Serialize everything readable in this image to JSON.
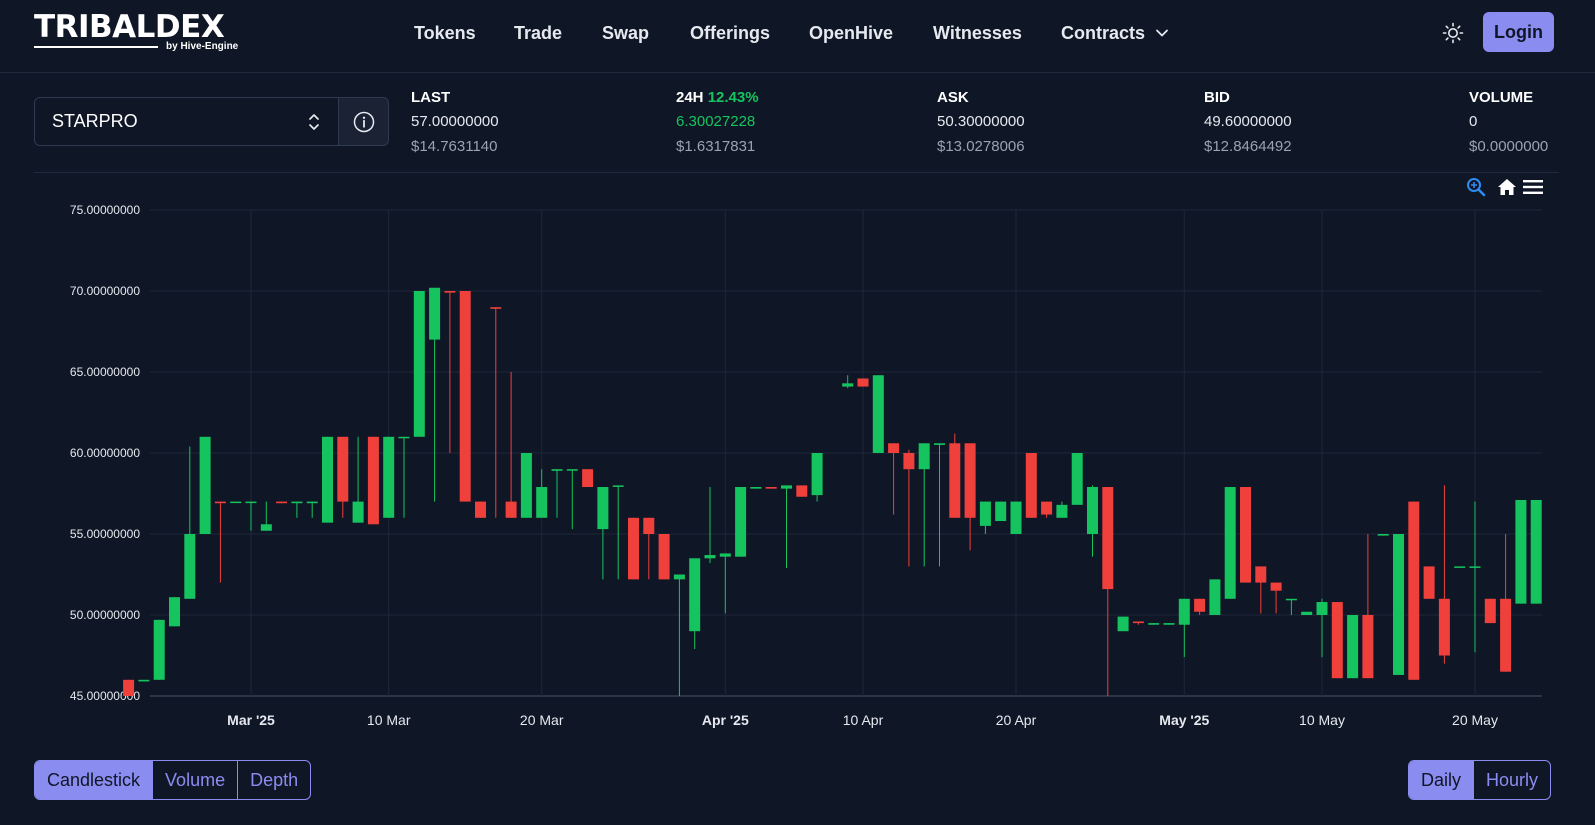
{
  "header": {
    "logo_text": "TRIBALDEX",
    "logo_sub": "by Hive-Engine",
    "nav": [
      "Tokens",
      "Trade",
      "Swap",
      "Offerings",
      "OpenHive",
      "Witnesses",
      "Contracts"
    ],
    "login_label": "Login"
  },
  "token": {
    "selected": "STARPRO"
  },
  "stats": {
    "last": {
      "label": "LAST",
      "value": "57.00000000",
      "usd": "$14.7631140"
    },
    "change": {
      "label": "24H",
      "pct": "12.43%",
      "value": "6.30027228",
      "usd": "$1.6317831"
    },
    "ask": {
      "label": "ASK",
      "value": "50.30000000",
      "usd": "$13.0278006"
    },
    "bid": {
      "label": "BID",
      "value": "49.60000000",
      "usd": "$12.8464492"
    },
    "volume": {
      "label": "VOLUME",
      "value": "0",
      "usd": "$0.0000000"
    }
  },
  "colors": {
    "up": "#16c45f",
    "down": "#f0403c",
    "accent": "#8b8cf0",
    "background": "#0f1626"
  },
  "chart_data": {
    "type": "candlestick",
    "title": "",
    "xlabel": "",
    "ylabel": "",
    "ylim": [
      45,
      75
    ],
    "y_ticks": [
      "75.00000000",
      "70.00000000",
      "65.00000000",
      "60.00000000",
      "55.00000000",
      "50.00000000",
      "45.00000000"
    ],
    "x_ticks": [
      {
        "date": "2025-03-01",
        "label": "Mar '25",
        "bold": true
      },
      {
        "date": "2025-03-10",
        "label": "10 Mar",
        "bold": false
      },
      {
        "date": "2025-03-20",
        "label": "20 Mar",
        "bold": false
      },
      {
        "date": "2025-04-01",
        "label": "Apr '25",
        "bold": true
      },
      {
        "date": "2025-04-10",
        "label": "10 Apr",
        "bold": false
      },
      {
        "date": "2025-04-20",
        "label": "20 Apr",
        "bold": false
      },
      {
        "date": "2025-05-01",
        "label": "May '25",
        "bold": true
      },
      {
        "date": "2025-05-10",
        "label": "10 May",
        "bold": false
      },
      {
        "date": "2025-05-20",
        "label": "20 May",
        "bold": false
      }
    ],
    "candles": [
      {
        "date": "2025-02-21",
        "open": 46.0,
        "high": 46.0,
        "low": 45.0,
        "close": 45.0
      },
      {
        "date": "2025-02-22",
        "open": 45.9,
        "high": 46.0,
        "low": 45.9,
        "close": 46.0
      },
      {
        "date": "2025-02-23",
        "open": 46.0,
        "high": 49.7,
        "low": 46.0,
        "close": 49.7
      },
      {
        "date": "2025-02-24",
        "open": 49.3,
        "high": 51.1,
        "low": 49.3,
        "close": 51.1
      },
      {
        "date": "2025-02-25",
        "open": 51.0,
        "high": 60.4,
        "low": 51.0,
        "close": 55.0
      },
      {
        "date": "2025-02-26",
        "open": 55.0,
        "high": 61.0,
        "low": 55.0,
        "close": 61.0
      },
      {
        "date": "2025-02-27",
        "open": 57.0,
        "high": 57.0,
        "low": 52.0,
        "close": 56.9
      },
      {
        "date": "2025-02-28",
        "open": 57.0,
        "high": 57.0,
        "low": 57.0,
        "close": 57.0
      },
      {
        "date": "2025-03-01",
        "open": 57.0,
        "high": 57.0,
        "low": 55.2,
        "close": 57.0
      },
      {
        "date": "2025-03-02",
        "open": 55.2,
        "high": 57.0,
        "low": 55.2,
        "close": 55.6
      },
      {
        "date": "2025-03-03",
        "open": 57.0,
        "high": 57.0,
        "low": 56.9,
        "close": 56.9
      },
      {
        "date": "2025-03-04",
        "open": 56.9,
        "high": 57.0,
        "low": 56.0,
        "close": 57.0
      },
      {
        "date": "2025-03-05",
        "open": 56.9,
        "high": 57.0,
        "low": 56.0,
        "close": 57.0
      },
      {
        "date": "2025-03-06",
        "open": 55.7,
        "high": 61.0,
        "low": 55.7,
        "close": 61.0
      },
      {
        "date": "2025-03-07",
        "open": 61.0,
        "high": 61.0,
        "low": 56.0,
        "close": 57.0
      },
      {
        "date": "2025-03-08",
        "open": 55.7,
        "high": 61.0,
        "low": 55.7,
        "close": 57.0
      },
      {
        "date": "2025-03-09",
        "open": 61.0,
        "high": 61.0,
        "low": 55.6,
        "close": 55.6
      },
      {
        "date": "2025-03-10",
        "open": 56.0,
        "high": 61.0,
        "low": 56.0,
        "close": 61.0
      },
      {
        "date": "2025-03-11",
        "open": 61.0,
        "high": 61.0,
        "low": 56.0,
        "close": 61.0
      },
      {
        "date": "2025-03-12",
        "open": 61.0,
        "high": 70.0,
        "low": 61.0,
        "close": 70.0
      },
      {
        "date": "2025-03-13",
        "open": 67.0,
        "high": 70.2,
        "low": 57.0,
        "close": 70.2
      },
      {
        "date": "2025-03-14",
        "open": 70.0,
        "high": 70.0,
        "low": 60.0,
        "close": 69.9
      },
      {
        "date": "2025-03-15",
        "open": 70.0,
        "high": 70.0,
        "low": 57.0,
        "close": 57.0
      },
      {
        "date": "2025-03-16",
        "open": 57.0,
        "high": 57.0,
        "low": 56.0,
        "close": 56.0
      },
      {
        "date": "2025-03-17",
        "open": 69.0,
        "high": 69.0,
        "low": 56.0,
        "close": 68.9
      },
      {
        "date": "2025-03-18",
        "open": 57.0,
        "high": 65.0,
        "low": 56.0,
        "close": 56.0
      },
      {
        "date": "2025-03-19",
        "open": 56.0,
        "high": 60.0,
        "low": 56.0,
        "close": 60.0
      },
      {
        "date": "2025-03-20",
        "open": 56.0,
        "high": 59.0,
        "low": 56.0,
        "close": 57.9
      },
      {
        "date": "2025-03-21",
        "open": 58.9,
        "high": 59.0,
        "low": 56.0,
        "close": 59.0
      },
      {
        "date": "2025-03-22",
        "open": 59.0,
        "high": 59.0,
        "low": 55.3,
        "close": 59.0
      },
      {
        "date": "2025-03-23",
        "open": 59.0,
        "high": 59.0,
        "low": 57.9,
        "close": 57.9
      },
      {
        "date": "2025-03-24",
        "open": 55.3,
        "high": 57.9,
        "low": 52.2,
        "close": 57.9
      },
      {
        "date": "2025-03-25",
        "open": 58.0,
        "high": 58.0,
        "low": 52.2,
        "close": 58.0
      },
      {
        "date": "2025-03-26",
        "open": 56.0,
        "high": 56.0,
        "low": 52.2,
        "close": 52.2
      },
      {
        "date": "2025-03-27",
        "open": 56.0,
        "high": 56.0,
        "low": 52.2,
        "close": 55.0
      },
      {
        "date": "2025-03-28",
        "open": 55.0,
        "high": 55.0,
        "low": 52.2,
        "close": 52.2
      },
      {
        "date": "2025-03-29",
        "open": 52.2,
        "high": 52.5,
        "low": 45.0,
        "close": 52.5
      },
      {
        "date": "2025-03-30",
        "open": 49.0,
        "high": 53.5,
        "low": 47.9,
        "close": 53.5
      },
      {
        "date": "2025-03-31",
        "open": 53.5,
        "high": 57.9,
        "low": 53.2,
        "close": 53.7
      },
      {
        "date": "2025-04-01",
        "open": 53.6,
        "high": 53.8,
        "low": 50.1,
        "close": 53.8
      },
      {
        "date": "2025-04-02",
        "open": 53.6,
        "high": 57.9,
        "low": 53.6,
        "close": 57.9
      },
      {
        "date": "2025-04-03",
        "open": 57.8,
        "high": 57.9,
        "low": 57.8,
        "close": 57.9
      },
      {
        "date": "2025-04-04",
        "open": 57.9,
        "high": 57.9,
        "low": 57.8,
        "close": 57.8
      },
      {
        "date": "2025-04-05",
        "open": 57.8,
        "high": 58.0,
        "low": 52.9,
        "close": 58.0
      },
      {
        "date": "2025-04-06",
        "open": 58.0,
        "high": 58.0,
        "low": 57.3,
        "close": 57.3
      },
      {
        "date": "2025-04-07",
        "open": 57.4,
        "high": 60.0,
        "low": 57.0,
        "close": 60.0
      },
      {
        "date": "2025-04-09",
        "open": 64.1,
        "high": 64.8,
        "low": 64.0,
        "close": 64.3
      },
      {
        "date": "2025-04-10",
        "open": 64.6,
        "high": 64.6,
        "low": 64.1,
        "close": 64.1
      },
      {
        "date": "2025-04-11",
        "open": 60.0,
        "high": 64.8,
        "low": 60.0,
        "close": 64.8
      },
      {
        "date": "2025-04-12",
        "open": 60.6,
        "high": 60.6,
        "low": 56.2,
        "close": 60.0
      },
      {
        "date": "2025-04-13",
        "open": 60.0,
        "high": 60.2,
        "low": 53.0,
        "close": 59.0
      },
      {
        "date": "2025-04-14",
        "open": 59.0,
        "high": 60.6,
        "low": 53.0,
        "close": 60.6
      },
      {
        "date": "2025-04-15",
        "open": 60.5,
        "high": 60.6,
        "low": 53.0,
        "close": 60.6
      },
      {
        "date": "2025-04-16",
        "open": 60.6,
        "high": 61.2,
        "low": 56.0,
        "close": 56.0
      },
      {
        "date": "2025-04-17",
        "open": 60.6,
        "high": 60.6,
        "low": 54.0,
        "close": 56.0
      },
      {
        "date": "2025-04-18",
        "open": 55.5,
        "high": 57.0,
        "low": 55.0,
        "close": 57.0
      },
      {
        "date": "2025-04-19",
        "open": 55.8,
        "high": 57.0,
        "low": 55.8,
        "close": 57.0
      },
      {
        "date": "2025-04-20",
        "open": 55.0,
        "high": 57.0,
        "low": 55.0,
        "close": 57.0
      },
      {
        "date": "2025-04-21",
        "open": 60.0,
        "high": 60.0,
        "low": 56.0,
        "close": 56.0
      },
      {
        "date": "2025-04-22",
        "open": 57.0,
        "high": 57.0,
        "low": 56.0,
        "close": 56.2
      },
      {
        "date": "2025-04-23",
        "open": 56.0,
        "high": 57.0,
        "low": 56.0,
        "close": 56.8
      },
      {
        "date": "2025-04-24",
        "open": 56.8,
        "high": 60.0,
        "low": 56.8,
        "close": 60.0
      },
      {
        "date": "2025-04-25",
        "open": 55.0,
        "high": 58.0,
        "low": 53.6,
        "close": 57.9
      },
      {
        "date": "2025-04-26",
        "open": 57.9,
        "high": 57.9,
        "low": 45.0,
        "close": 51.6
      },
      {
        "date": "2025-04-27",
        "open": 49.0,
        "high": 49.9,
        "low": 49.0,
        "close": 49.9
      },
      {
        "date": "2025-04-28",
        "open": 49.6,
        "high": 49.6,
        "low": 49.4,
        "close": 49.5
      },
      {
        "date": "2025-04-29",
        "open": 49.4,
        "high": 49.5,
        "low": 49.4,
        "close": 49.5
      },
      {
        "date": "2025-04-30",
        "open": 49.4,
        "high": 49.5,
        "low": 49.4,
        "close": 49.5
      },
      {
        "date": "2025-05-01",
        "open": 49.4,
        "high": 51.0,
        "low": 47.4,
        "close": 51.0
      },
      {
        "date": "2025-05-02",
        "open": 51.0,
        "high": 51.0,
        "low": 50.0,
        "close": 50.2
      },
      {
        "date": "2025-05-03",
        "open": 50.0,
        "high": 52.2,
        "low": 50.0,
        "close": 52.2
      },
      {
        "date": "2025-05-04",
        "open": 51.0,
        "high": 57.9,
        "low": 51.0,
        "close": 57.9
      },
      {
        "date": "2025-05-05",
        "open": 57.9,
        "high": 57.9,
        "low": 52.0,
        "close": 52.0
      },
      {
        "date": "2025-05-06",
        "open": 53.0,
        "high": 53.0,
        "low": 50.1,
        "close": 52.0
      },
      {
        "date": "2025-05-07",
        "open": 52.0,
        "high": 52.0,
        "low": 50.1,
        "close": 51.5
      },
      {
        "date": "2025-05-08",
        "open": 51.0,
        "high": 51.0,
        "low": 50.0,
        "close": 51.0
      },
      {
        "date": "2025-05-09",
        "open": 50.0,
        "high": 50.2,
        "low": 50.0,
        "close": 50.2
      },
      {
        "date": "2025-05-10",
        "open": 50.0,
        "high": 51.0,
        "low": 47.4,
        "close": 50.8
      },
      {
        "date": "2025-05-11",
        "open": 50.8,
        "high": 50.8,
        "low": 46.1,
        "close": 46.1
      },
      {
        "date": "2025-05-12",
        "open": 46.1,
        "high": 50.0,
        "low": 46.1,
        "close": 50.0
      },
      {
        "date": "2025-05-13",
        "open": 50.0,
        "high": 55.0,
        "low": 46.1,
        "close": 46.1
      },
      {
        "date": "2025-05-14",
        "open": 54.9,
        "high": 55.0,
        "low": 54.9,
        "close": 55.0
      },
      {
        "date": "2025-05-15",
        "open": 46.3,
        "high": 55.0,
        "low": 46.3,
        "close": 55.0
      },
      {
        "date": "2025-05-16",
        "open": 57.0,
        "high": 57.0,
        "low": 46.0,
        "close": 46.0
      },
      {
        "date": "2025-05-17",
        "open": 53.0,
        "high": 53.0,
        "low": 51.0,
        "close": 51.0
      },
      {
        "date": "2025-05-18",
        "open": 51.0,
        "high": 58.0,
        "low": 47.0,
        "close": 47.5
      },
      {
        "date": "2025-05-19",
        "open": 53.0,
        "high": 53.0,
        "low": 53.0,
        "close": 53.0
      },
      {
        "date": "2025-05-20",
        "open": 53.0,
        "high": 57.0,
        "low": 47.7,
        "close": 53.0
      },
      {
        "date": "2025-05-21",
        "open": 51.0,
        "high": 51.0,
        "low": 49.5,
        "close": 49.5
      },
      {
        "date": "2025-05-22",
        "open": 51.0,
        "high": 55.0,
        "low": 46.5,
        "close": 46.5
      },
      {
        "date": "2025-05-23",
        "open": 50.7,
        "high": 57.1,
        "low": 50.7,
        "close": 57.1
      },
      {
        "date": "2025-05-24",
        "open": 50.7,
        "high": 57.1,
        "low": 50.7,
        "close": 57.1
      }
    ]
  },
  "chart_tabs": [
    "Candlestick",
    "Volume",
    "Depth"
  ],
  "interval_tabs": [
    "Daily",
    "Hourly"
  ],
  "icons": [
    "sun-icon",
    "chevron-down-icon",
    "up-down-icon",
    "info-icon",
    "zoom-icon",
    "home-icon",
    "menu-icon"
  ]
}
